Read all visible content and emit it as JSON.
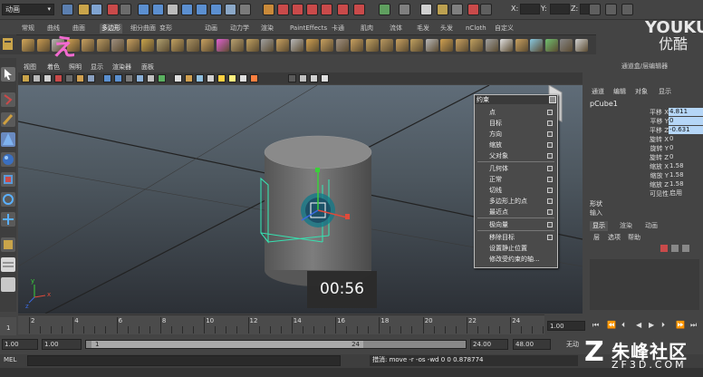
{
  "status_line": {
    "mode": "动画",
    "coord_labels": [
      "X:",
      "Y:",
      "Z:"
    ]
  },
  "watermark_top": {
    "line1": "YOUKU",
    "line2": "优酷"
  },
  "shelf_tabs": [
    "常规",
    "曲线",
    "曲面",
    "多边形",
    "细分曲面",
    "变形",
    "动画",
    "动力学",
    "渲染",
    "PaintEffects",
    "卡通",
    "肌肉",
    "流体",
    "毛发",
    "头发",
    "nCloth",
    "自定义"
  ],
  "shelf_active": 3,
  "shelf_annotation": "え",
  "viewport": {
    "menus": [
      "视图",
      "着色",
      "照明",
      "显示",
      "渲染器",
      "面板"
    ]
  },
  "constraint_menu": {
    "title": "约束",
    "items": [
      "点",
      "目标",
      "方向",
      "缩放",
      "父对象",
      "几何体",
      "正常",
      "切线",
      "多边形上的点",
      "最近点",
      "极向量",
      "移除目标",
      "设置静止位置",
      "修改受约束的轴..."
    ],
    "has_option_box": [
      true,
      true,
      true,
      true,
      true,
      true,
      true,
      true,
      true,
      true,
      true,
      true,
      false,
      false
    ]
  },
  "timer": "00:56",
  "channel_box": {
    "title": "通道盒/层编辑器",
    "menus": [
      "通道",
      "编辑",
      "对象",
      "显示"
    ],
    "object": "pCube1",
    "attributes": [
      {
        "name": "平移 X",
        "value": "4.811",
        "highlight": true
      },
      {
        "name": "平移 Y",
        "value": "0",
        "highlight": true
      },
      {
        "name": "平移 Z",
        "value": "-0.631",
        "highlight": true
      },
      {
        "name": "旋转 X",
        "value": "0",
        "highlight": false
      },
      {
        "name": "旋转 Y",
        "value": "0",
        "highlight": false
      },
      {
        "name": "旋转 Z",
        "value": "0",
        "highlight": false
      },
      {
        "name": "缩放 X",
        "value": "1.58",
        "highlight": false
      },
      {
        "name": "缩放 Y",
        "value": "1.58",
        "highlight": false
      },
      {
        "name": "缩放 Z",
        "value": "1.58",
        "highlight": false
      },
      {
        "name": "可见性",
        "value": "启用",
        "highlight": false
      }
    ],
    "shape_label": "形状",
    "inputs_label": "输入",
    "layer_tabs": [
      "显示",
      "渲染",
      "动画"
    ],
    "layer_menus": [
      "层",
      "选项",
      "帮助"
    ]
  },
  "time_slider": {
    "ticks": [
      "2",
      "4",
      "6",
      "8",
      "10",
      "12",
      "14",
      "16",
      "18",
      "20",
      "22",
      "24"
    ],
    "current_frame": "1",
    "time_field": "1.00"
  },
  "range": {
    "start": "1.00",
    "start2": "1.00",
    "inner_start": "1",
    "inner_end": "24",
    "end": "24.00",
    "end2": "48.00",
    "anim_layer": "无动"
  },
  "command_line": {
    "label": "MEL",
    "result": "措消: move -r -os -wd 0 0 0.878774"
  },
  "watermark_bottom": {
    "mark": "Z",
    "cn": "朱峰社区",
    "en": "ZF3D.COM"
  }
}
